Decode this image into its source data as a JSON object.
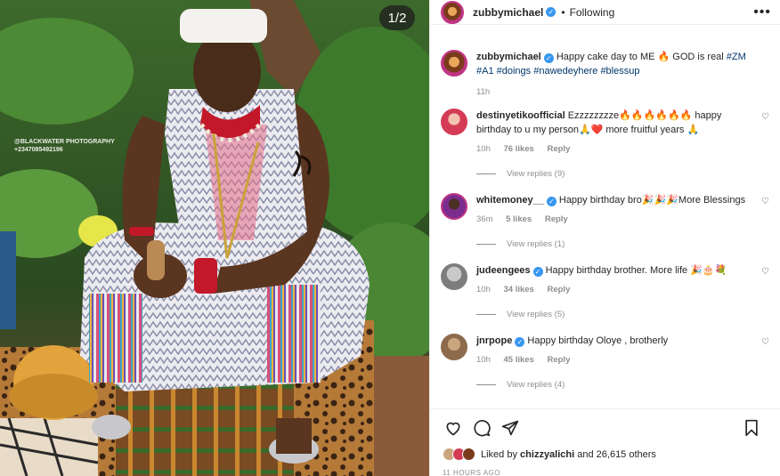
{
  "post": {
    "username": "zubbymichael",
    "follow_status": "Following",
    "more_label": "•••",
    "image_counter": "1/2",
    "watermark_line1": "@BLACKWATER PHOTOGRAPHY",
    "watermark_line2": "+2347085492196"
  },
  "caption": {
    "username": "zubbymichael",
    "text": "Happy cake day to ME 🔥 GOD is real",
    "hashtags": "#ZM #A1 #doings #nawedeyhere #blessup",
    "time": "11h"
  },
  "comments": [
    {
      "username": "destinyetikoofficial",
      "text": "Ezzzzzzzze🔥🔥🔥🔥🔥🔥 happy birthday to u my person🙏❤️ more fruitful years 🙏",
      "time": "10h",
      "likes": "76 likes",
      "reply_label": "Reply",
      "view_replies": "View replies (9)",
      "verified": false
    },
    {
      "username": "whitemoney__",
      "text": "Happy birthday bro🎉🎉🎉More Blessings",
      "time": "36m",
      "likes": "5 likes",
      "reply_label": "Reply",
      "view_replies": "View replies (1)",
      "verified": true
    },
    {
      "username": "judeengees",
      "text": "Happy birthday brother. More life 🎉🎂💐",
      "time": "10h",
      "likes": "34 likes",
      "reply_label": "Reply",
      "view_replies": "View replies (5)",
      "verified": true
    },
    {
      "username": "jnrpope",
      "text": "Happy birthday Oloye , brotherly",
      "time": "10h",
      "likes": "45 likes",
      "reply_label": "Reply",
      "view_replies": "View replies (4)",
      "verified": true
    }
  ],
  "footer": {
    "liked_by_prefix": "Liked by",
    "liked_by_user": "chizzyalichi",
    "liked_by_suffix": "and 26,615 others",
    "time_ago": "11 HOURS AGO"
  },
  "icons": {
    "like": "heart-icon",
    "comment": "comment-icon",
    "share": "share-icon",
    "save": "bookmark-icon",
    "verified": "verified-badge-icon"
  },
  "colors": {
    "verified": "#3897f0",
    "hashtag": "#00376b",
    "meta": "#8e8e8e"
  }
}
